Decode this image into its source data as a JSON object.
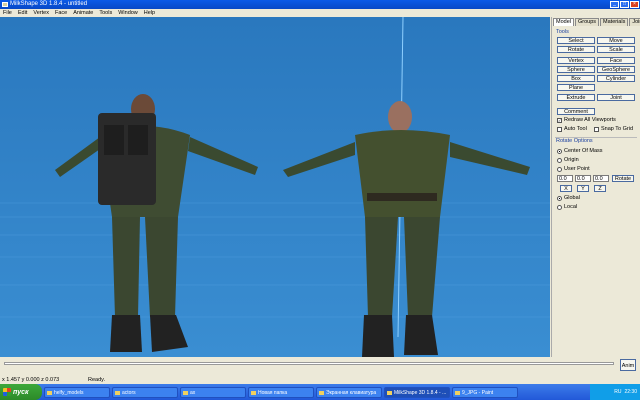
{
  "window": {
    "title": "MilkShape 3D 1.8.4 - untitled"
  },
  "menu": [
    "File",
    "Edit",
    "Vertex",
    "Face",
    "Animate",
    "Tools",
    "Window",
    "Help"
  ],
  "panel": {
    "tabs": [
      "Model",
      "Groups",
      "Materials",
      "Joints"
    ],
    "tools_label": "Tools",
    "tools": [
      "Select",
      "Move",
      "Rotate",
      "Scale",
      "Vertex",
      "Face",
      "Sphere",
      "GeoSphere",
      "Box",
      "Cylinder",
      "Plane",
      "Extrude",
      "Joint",
      "Comment"
    ],
    "redraw": "Redraw All Viewports",
    "auto_tool": "Auto Tool",
    "snap": "Snap To Grid",
    "rotate_options_label": "Rotate Options",
    "center_of_mass": "Center Of Mass",
    "origin": "Origin",
    "user_point": "User Point",
    "point_values": [
      "0.0",
      "0.0",
      "0.0"
    ],
    "rotate_btn": "Rotate",
    "axes": [
      "X",
      "Y",
      "Z"
    ],
    "global": "Global",
    "local": "Local"
  },
  "timeline": {
    "anim_label": "Anim"
  },
  "status": {
    "coords": "x 1.457 y 0.000 z 0.073",
    "text": "Ready."
  },
  "taskbar": {
    "start": "пуск",
    "tasks": [
      "helfy_models",
      "actors",
      "ax",
      "Новая папка",
      "Экранная клавиатура",
      "MilkShape 3D 1.8.4 - ...",
      "9_JPG - Paint"
    ],
    "lang": "RU",
    "clock": "22:30"
  }
}
